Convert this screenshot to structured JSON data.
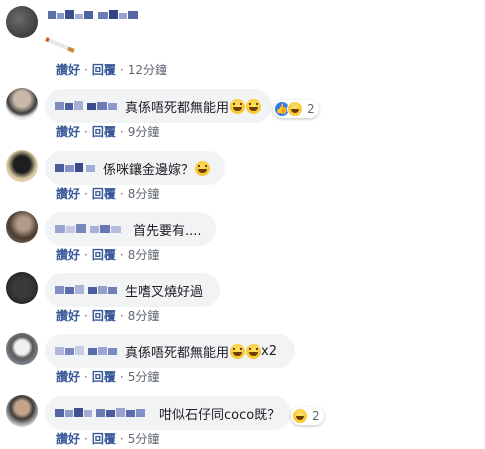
{
  "actions": {
    "like": "讚好",
    "reply": "回覆",
    "dot": "·"
  },
  "comments": [
    {
      "text": "",
      "time": "12分鐘"
    },
    {
      "text": "真係唔死都無能用",
      "time": "9分鐘",
      "reaction_count": "2"
    },
    {
      "text": "係咪鑲金邊嫁？",
      "time": "8分鐘"
    },
    {
      "text": "首先要有....",
      "time": "8分鐘"
    },
    {
      "text": "生嗜叉燒好過",
      "time": "8分鐘"
    },
    {
      "text": "真係唔死都無能用",
      "suffix": "x2",
      "time": "5分鐘"
    },
    {
      "text": "咁似石仔同coco既？",
      "time": "5分鐘",
      "reaction_count": "2"
    }
  ],
  "colors": {
    "link": "#385898",
    "bubble": "#f2f3f5",
    "like": "#2e7cf6"
  }
}
